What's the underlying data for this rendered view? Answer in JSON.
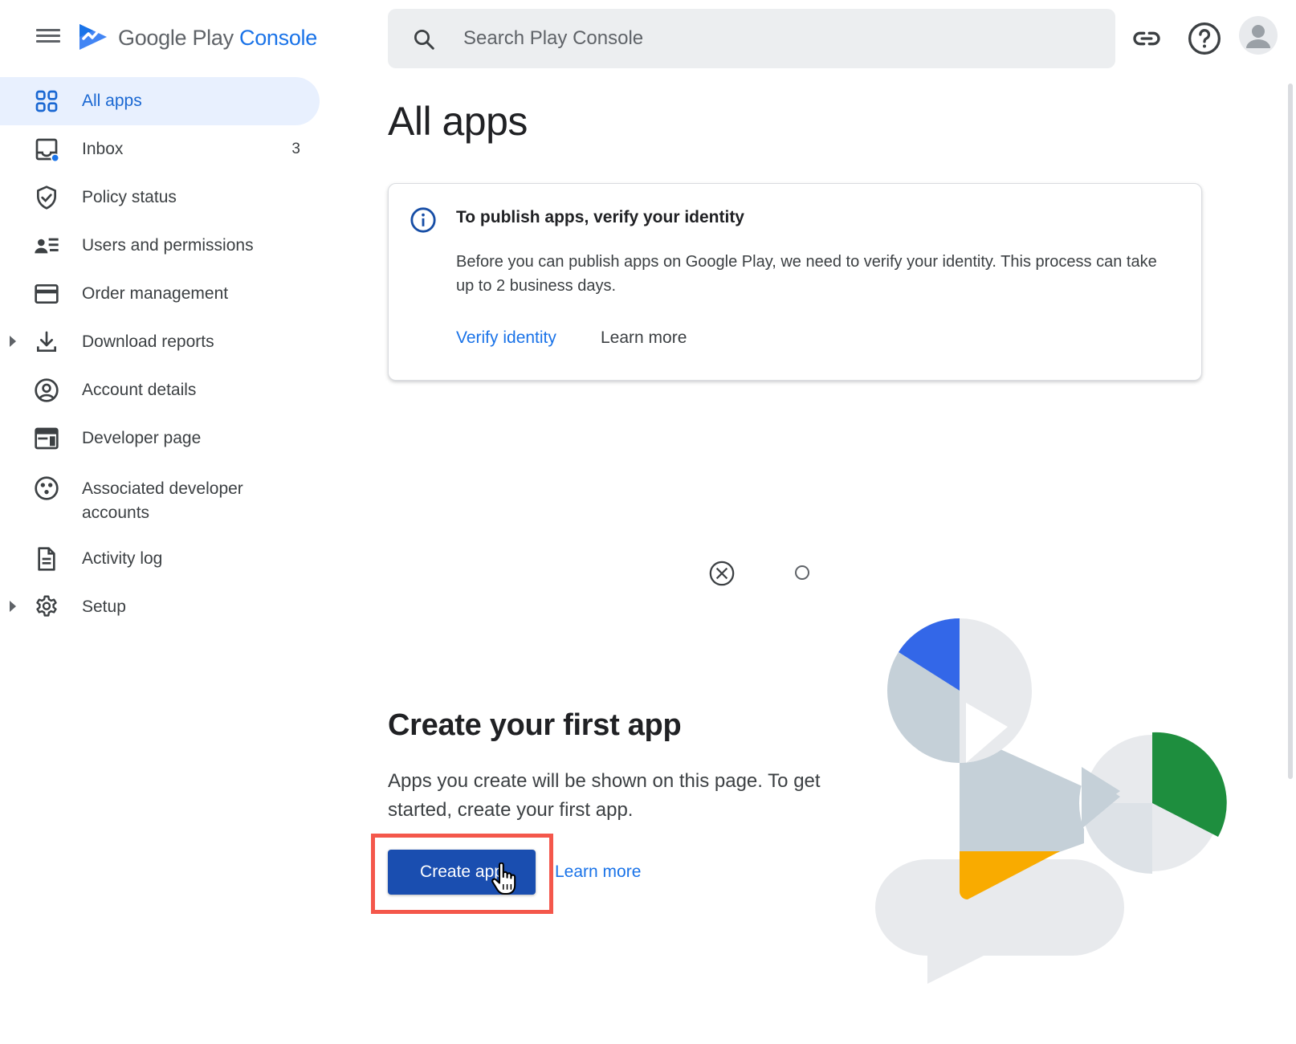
{
  "header": {
    "brand_google": "Google Play",
    "brand_console": "Console",
    "search_placeholder": "Search Play Console"
  },
  "sidebar": {
    "items": [
      {
        "label": "All apps",
        "icon": "grid-icon",
        "active": true
      },
      {
        "label": "Inbox",
        "icon": "inbox-icon",
        "badge": "3"
      },
      {
        "label": "Policy status",
        "icon": "shield-icon"
      },
      {
        "label": "Users and permissions",
        "icon": "users-icon"
      },
      {
        "label": "Order management",
        "icon": "credit-card-icon"
      },
      {
        "label": "Download reports",
        "icon": "download-icon",
        "expandable": true
      },
      {
        "label": "Account details",
        "icon": "account-circle-icon"
      },
      {
        "label": "Developer page",
        "icon": "web-page-icon"
      },
      {
        "label": "Associated developer accounts",
        "icon": "linked-accounts-icon"
      },
      {
        "label": "Activity log",
        "icon": "document-icon"
      },
      {
        "label": "Setup",
        "icon": "gear-icon",
        "expandable": true
      }
    ]
  },
  "main": {
    "title": "All apps",
    "notice": {
      "title": "To publish apps, verify your identity",
      "body": "Before you can publish apps on Google Play, we need to verify your identity. This process can take up to 2 business days.",
      "verify_label": "Verify identity",
      "learn_more_label": "Learn more"
    },
    "empty_state": {
      "title": "Create your first app",
      "body": "Apps you create will be shown on this page. To get started, create your first app.",
      "create_label": "Create app",
      "learn_more_label": "Learn more"
    }
  },
  "colors": {
    "accent": "#1a73e8",
    "primary_button": "#1a4eb0",
    "active_nav_bg": "#e8f0fe",
    "highlight": "#f4574b",
    "illustration_blue": "#3367e8",
    "illustration_green": "#1e8e3e",
    "illustration_yellow": "#f9ab00",
    "illustration_grey": "#c5d0d8"
  }
}
